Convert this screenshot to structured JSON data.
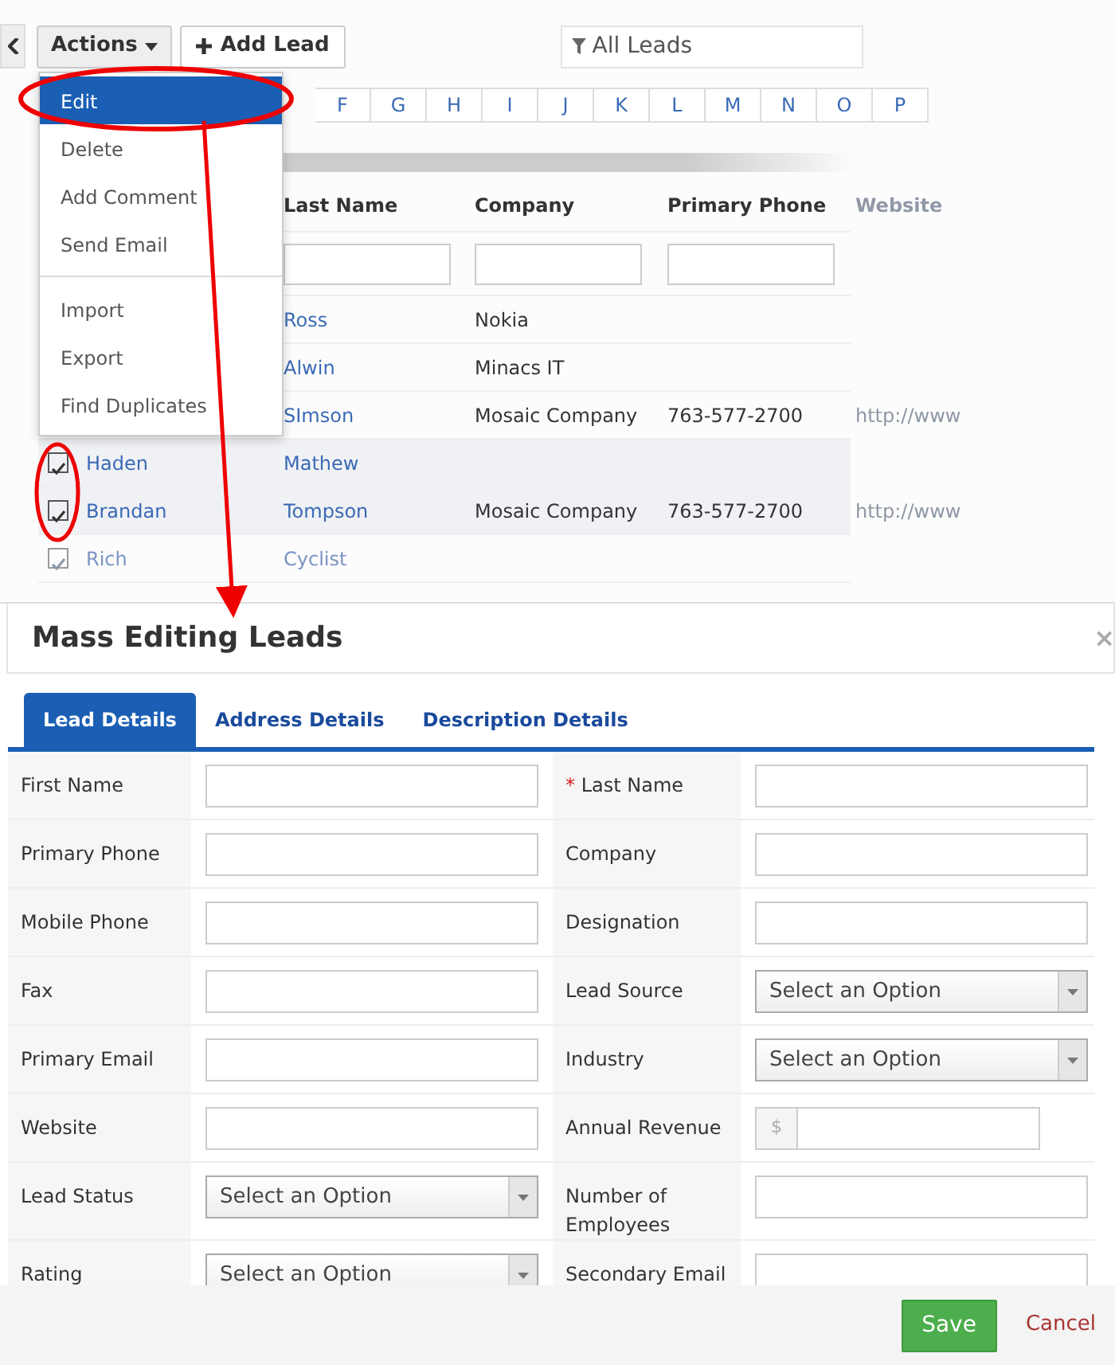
{
  "toolbar": {
    "actions_label": "Actions",
    "add_label": "Add Lead",
    "filter_label": "All Leads"
  },
  "actions_menu": [
    {
      "label": "Edit",
      "selected": true,
      "divider_before": false
    },
    {
      "label": "Delete",
      "selected": false,
      "divider_before": false
    },
    {
      "label": "Add Comment",
      "selected": false,
      "divider_before": false
    },
    {
      "label": "Send Email",
      "selected": false,
      "divider_before": false
    },
    {
      "label": "Import",
      "selected": false,
      "divider_before": true
    },
    {
      "label": "Export",
      "selected": false,
      "divider_before": false
    },
    {
      "label": "Find Duplicates",
      "selected": false,
      "divider_before": false
    }
  ],
  "letters": [
    "F",
    "G",
    "H",
    "I",
    "J",
    "K",
    "L",
    "M",
    "N",
    "O",
    "P"
  ],
  "table": {
    "columns": [
      "Last Name",
      "Company",
      "Primary Phone",
      "Website"
    ],
    "rows": [
      {
        "last_name": "Ross",
        "company": "Nokia",
        "phone": "",
        "website": "",
        "dimmed": false
      },
      {
        "last_name": "Alwin",
        "company": "Minacs IT",
        "phone": "",
        "website": "",
        "dimmed": false
      },
      {
        "last_name": "SImson",
        "company": "Mosaic Company",
        "phone": "763-577-2700",
        "website": "http://www",
        "dimmed": false
      },
      {
        "first_name": "Haden",
        "last_name": "Mathew",
        "company": "",
        "phone": "",
        "website": "",
        "checked": true,
        "dimmed": false
      },
      {
        "first_name": "Brandan",
        "last_name": "Tompson",
        "company": "Mosaic Company",
        "phone": "763-577-2700",
        "website": "http://www",
        "checked": true,
        "dimmed": false
      },
      {
        "first_name": "Rich",
        "last_name": "Cyclist",
        "company": "",
        "phone": "",
        "website": "",
        "checked": true,
        "dimmed": true
      }
    ]
  },
  "modal": {
    "title": "Mass Editing Leads",
    "close": "×",
    "tabs": [
      {
        "label": "Lead Details",
        "selected": true
      },
      {
        "label": "Address Details",
        "selected": false
      },
      {
        "label": "Description Details",
        "selected": false
      }
    ],
    "rows": [
      [
        {
          "label": "First Name",
          "kind": "input"
        },
        {
          "required_mark": "*",
          "label": "Last Name",
          "kind": "input"
        }
      ],
      [
        {
          "label": "Primary Phone",
          "kind": "input"
        },
        {
          "label": "Company",
          "kind": "input"
        }
      ],
      [
        {
          "label": "Mobile Phone",
          "kind": "input"
        },
        {
          "label": "Designation",
          "kind": "input"
        }
      ],
      [
        {
          "label": "Fax",
          "kind": "input"
        },
        {
          "label": "Lead Source",
          "kind": "select",
          "placeholder": "Select an Option"
        }
      ],
      [
        {
          "label": "Primary Email",
          "kind": "input"
        },
        {
          "label": "Industry",
          "kind": "select",
          "placeholder": "Select an Option"
        }
      ],
      [
        {
          "label": "Website",
          "kind": "input"
        },
        {
          "label": "Annual Revenue",
          "kind": "currency",
          "prefix": "$"
        }
      ],
      [
        {
          "label": "Lead Status",
          "kind": "select",
          "placeholder": "Select an Option"
        },
        {
          "label": "Number of Employees",
          "kind": "input"
        }
      ],
      [
        {
          "label": "Rating",
          "kind": "select",
          "placeholder": "Select an Option"
        },
        {
          "label": "Secondary Email",
          "kind": "input"
        }
      ]
    ],
    "save": "Save",
    "cancel": "Cancel"
  }
}
